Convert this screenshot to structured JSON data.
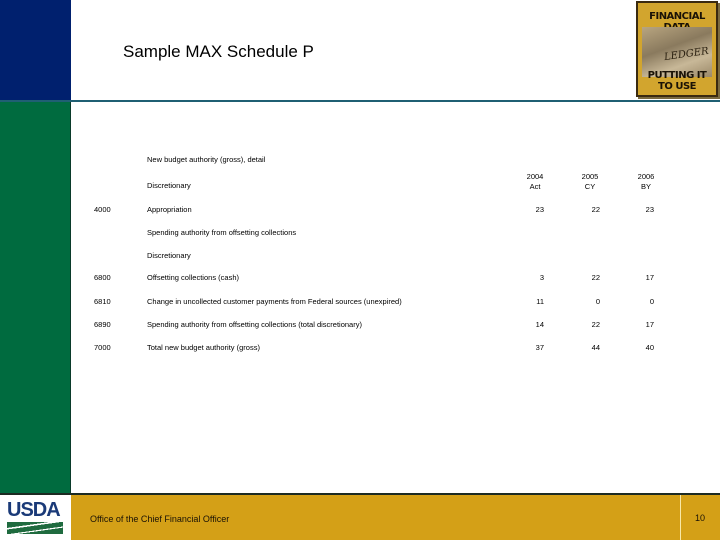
{
  "slide": {
    "title": "Sample MAX Schedule P",
    "logo": {
      "top_text": "FINANCIAL DATA",
      "image_text": "LEDGER",
      "bottom_text": "PUTTING IT TO USE"
    }
  },
  "table": {
    "section_title": "New budget authority (gross), detail",
    "columns": [
      {
        "year": "2004",
        "label": "Act"
      },
      {
        "year": "2005",
        "label": "CY"
      },
      {
        "year": "2006",
        "label": "BY"
      }
    ],
    "rows": [
      {
        "code": "",
        "desc": "Discretionary",
        "values": [
          "",
          "",
          ""
        ]
      },
      {
        "code": "4000",
        "desc": "Appropriation",
        "values": [
          "23",
          "22",
          "23"
        ]
      },
      {
        "code": "",
        "desc": "Spending authority from offsetting collections",
        "values": [
          "",
          "",
          ""
        ]
      },
      {
        "code": "",
        "desc": "Discretionary",
        "values": [
          "",
          "",
          ""
        ]
      },
      {
        "code": "6800",
        "desc": "Offsetting collections (cash)",
        "values": [
          "3",
          "22",
          "17"
        ]
      },
      {
        "code": "6810",
        "desc": "Change in uncollected customer payments from Federal sources (unexpired)",
        "values": [
          "11",
          "0",
          "0"
        ]
      },
      {
        "code": "6890",
        "desc": "Spending authority from offsetting collections (total discretionary)",
        "values": [
          "14",
          "22",
          "17"
        ]
      },
      {
        "code": "7000",
        "desc": "Total new budget authority (gross)",
        "values": [
          "37",
          "44",
          "40"
        ]
      }
    ]
  },
  "footer": {
    "agency_logo": "USDA",
    "office": "Office of the Chief Financial Officer",
    "page_number": "10"
  },
  "colors": {
    "sidebar_blue": "#00206e",
    "sidebar_green": "#006b3f",
    "footer_gold": "#d4a017",
    "rule": "#1f5f73"
  }
}
